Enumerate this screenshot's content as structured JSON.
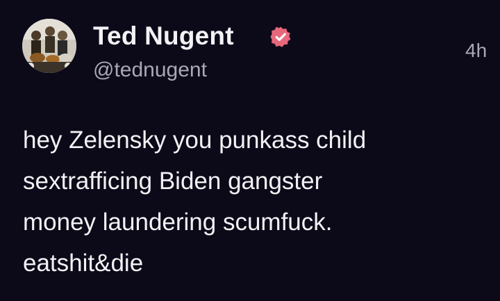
{
  "post": {
    "author": {
      "display_name": "Ted Nugent",
      "handle": "@tednugent",
      "verified": true,
      "avatar_icon": "band-photo-avatar",
      "verified_icon": "verified-badge-icon"
    },
    "timestamp": "4h",
    "body_lines": [
      "hey Zelensky you punkass child",
      "sextrafficing Biden gangster",
      "money laundering scumfuck.",
      "eatshit&die"
    ]
  },
  "colors": {
    "background": "#0c0a19",
    "text_primary": "#f2f2f4",
    "text_secondary": "#a9a8b4",
    "verified_badge": "#e8677c"
  }
}
